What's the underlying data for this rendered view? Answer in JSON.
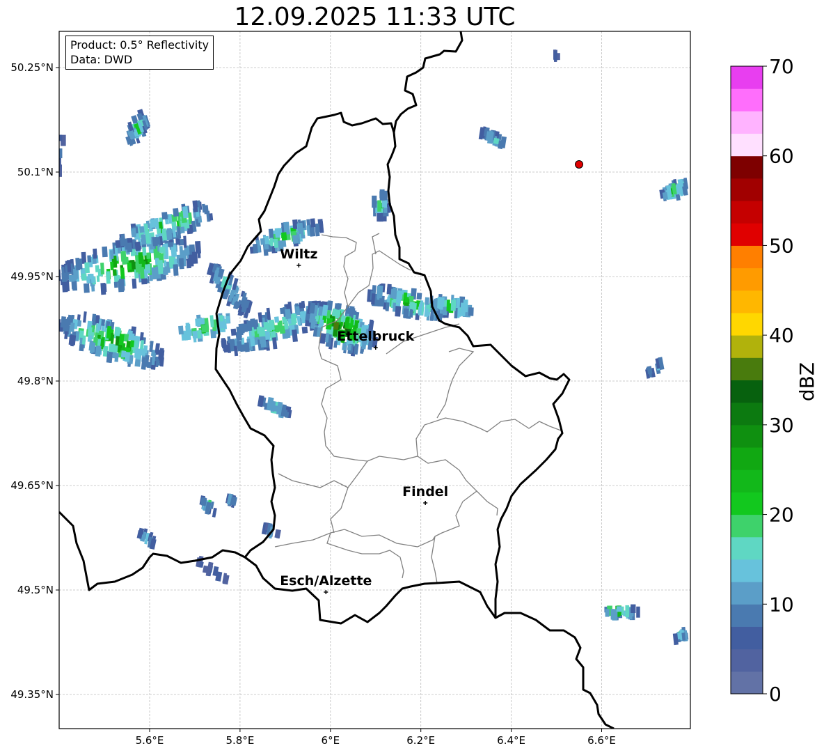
{
  "title": "12.09.2025 11:33 UTC",
  "info_box": {
    "product": "Product: 0.5° Reflectivity",
    "data": "Data: DWD"
  },
  "lon_ticks": [
    "5.6°E",
    "5.8°E",
    "6°E",
    "6.2°E",
    "6.4°E",
    "6.6°E"
  ],
  "lat_ticks": [
    "50.25°N",
    "50.1°N",
    "49.95°N",
    "49.8°N",
    "49.65°N",
    "49.5°N",
    "49.35°N"
  ],
  "cities": [
    {
      "name": "Wiltz",
      "lon": 5.93,
      "lat": 49.966
    },
    {
      "name": "Ettelbruck",
      "lon": 6.1,
      "lat": 49.848
    },
    {
      "name": "Findel",
      "lon": 6.21,
      "lat": 49.625
    },
    {
      "name": "Esch/Alzette",
      "lon": 5.99,
      "lat": 49.497
    }
  ],
  "marker": {
    "lon": 6.55,
    "lat": 50.111,
    "color": "#e00000"
  },
  "colorbar": {
    "label": "dBZ",
    "ticks": [
      "0",
      "10",
      "20",
      "30",
      "40",
      "50",
      "60",
      "70"
    ],
    "colors": [
      "#6272a6",
      "#5163a0",
      "#425ea0",
      "#4a7ab0",
      "#5b9ec8",
      "#67c2dc",
      "#5fd7c3",
      "#3ed26b",
      "#12c81e",
      "#12b81a",
      "#11a812",
      "#0f9010",
      "#0c7a10",
      "#07610e",
      "#497b0d",
      "#b1b20c",
      "#ffd700",
      "#ffb700",
      "#ff9b00",
      "#ff7f00",
      "#e00000",
      "#c50000",
      "#a10000",
      "#7e0000",
      "#ffe0ff",
      "#ffb3ff",
      "#ff6efc",
      "#e83ef0"
    ]
  }
}
